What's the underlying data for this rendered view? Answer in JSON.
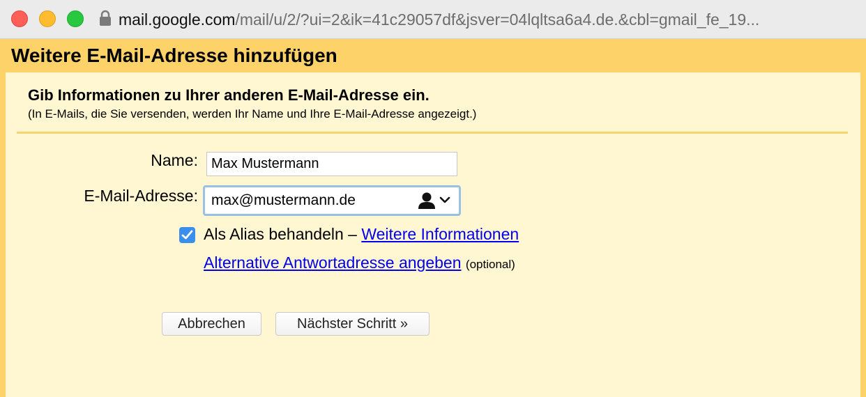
{
  "browser": {
    "url_domain": "mail.google.com",
    "url_path": "/mail/u/2/?ui=2&ik=41c29057df&jsver=04lqltsa6a4.de.&cbl=gmail_fe_19..."
  },
  "dialog": {
    "title": "Weitere E-Mail-Adresse hinzufügen",
    "heading": "Gib Informationen zu Ihrer anderen E-Mail-Adresse ein.",
    "subheading": "(In E-Mails, die Sie versenden, werden Ihr Name und Ihre E-Mail-Adresse angezeigt.)"
  },
  "form": {
    "name_label": "Name:",
    "name_value": "Max Mustermann",
    "email_label": "E-Mail-Adresse:",
    "email_value": "max@mustermann.de",
    "alias_checked": true,
    "alias_text": "Als Alias behandeln – ",
    "alias_link": "Weitere Informationen",
    "reply_link": "Alternative Antwortadresse angeben",
    "reply_optional": "(optional)"
  },
  "buttons": {
    "cancel": "Abbrechen",
    "next": "Nächster Schritt »"
  },
  "colors": {
    "header_bg": "#fdd268",
    "panel_bg": "#fff7d2",
    "checkbox": "#3b8fec",
    "link": "#0000ee"
  },
  "icons": {
    "lock": "lock-icon",
    "contacts": "person-icon",
    "dropdown": "chevron-down-icon",
    "check": "checkmark-icon"
  }
}
